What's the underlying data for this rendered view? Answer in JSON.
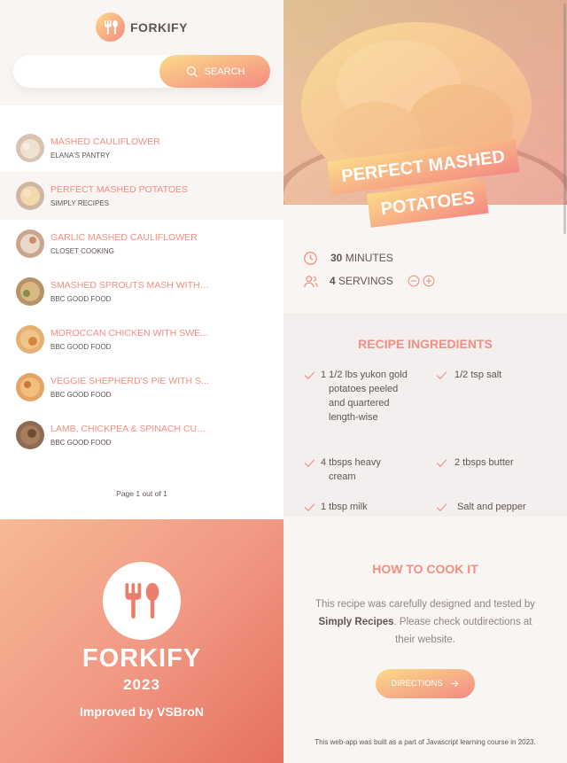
{
  "app": {
    "logo_text": "FORKIFY"
  },
  "search": {
    "placeholder": "",
    "button_label": "SEARCH"
  },
  "results": [
    {
      "title": "MASHED CAULIFLOWER",
      "publisher": "ELANA'S PANTRY",
      "active": false
    },
    {
      "title": "PERFECT MASHED POTATOES",
      "publisher": "SIMPLY RECIPES",
      "active": true
    },
    {
      "title": "GARLIC MASHED CAULIFLOWER",
      "publisher": "CLOSET COOKING",
      "active": false
    },
    {
      "title": "SMASHED SPROUTS MASH WITH ...",
      "publisher": "BBC GOOD FOOD",
      "active": false
    },
    {
      "title": "MOROCCAN CHICKEN WITH SWE...",
      "publisher": "BBC GOOD FOOD",
      "active": false
    },
    {
      "title": "VEGGIE SHEPHERD'S PIE WITH S...",
      "publisher": "BBC GOOD FOOD",
      "active": false
    },
    {
      "title": "LAMB, CHICKPEA & SPINACH CUR...",
      "publisher": "BBC GOOD FOOD",
      "active": false
    }
  ],
  "pagination": {
    "text": "Page 1 out of 1"
  },
  "promo": {
    "title": "FORKIFY",
    "year": "2023",
    "credit": "Improved by VSBroN"
  },
  "recipe": {
    "title_line1": "PERFECT MASHED",
    "title_line2": "POTATOES",
    "minutes_value": "30",
    "minutes_label": "MINUTES",
    "servings_value": "4",
    "servings_label": "SERVINGS",
    "ingredients_title": "RECIPE INGREDIENTS",
    "ingredients": [
      "1 1/2 lbs yukon gold potatoes peeled and quartered length-wise",
      "1/2 tsp salt",
      "4 tbsps heavy cream",
      "2 tbsps butter",
      "1 tbsp milk",
      "Salt and pepper"
    ],
    "cook_title": "HOW TO COOK IT",
    "cook_text_before": "This recipe was carefully designed and tested by ",
    "cook_publisher": "Simply Recipes",
    "cook_text_after": ". Please check outdirections at their website.",
    "directions_label": "DIRECTIONS"
  },
  "footer": {
    "text": "This web-app was built as a part of Javascript learning course in 2023."
  },
  "colors": {
    "accent": "#f38e82",
    "gradient_start": "#fbdb89",
    "gradient_end": "#f48982",
    "text": "#615551"
  },
  "icons": {
    "logo": "fork-spoon-icon",
    "search": "search-icon",
    "clock": "clock-icon",
    "users": "users-icon",
    "minus": "minus-circle-icon",
    "plus": "plus-circle-icon",
    "check": "check-icon",
    "arrow": "arrow-right-icon"
  }
}
